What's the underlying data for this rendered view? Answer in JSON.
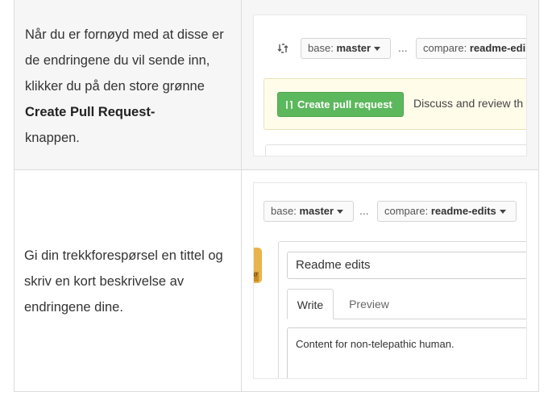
{
  "rows": [
    {
      "text_parts": [
        "Når du er fornøyd med at disse er de endringene du vil sende inn, klikker du på den store grønne ",
        "Create Pull Request-",
        "knappen."
      ],
      "screenshot": {
        "base_label": "base:",
        "base_value": "master",
        "separator": "...",
        "compare_label": "compare:",
        "compare_value": "readme-edi",
        "button_label": "Create pull request",
        "discuss_text": "Discuss and review th"
      }
    },
    {
      "text": "Gi din trekkforespørsel en tittel og skriv en kort beskrivelse av endringene dine.",
      "screenshot": {
        "base_label": "base:",
        "base_value": "master",
        "separator": "...",
        "compare_label": "compare:",
        "compare_value": "readme-edits",
        "avatar_text": "07",
        "title_value": "Readme edits",
        "tab_write": "Write",
        "tab_preview": "Preview",
        "body_value": "Content for non-telepathic human."
      }
    }
  ],
  "colors": {
    "accent_green": "#5cb85c",
    "notice_yellow": "#fffcea",
    "row_shade": "#f6f6f6"
  }
}
